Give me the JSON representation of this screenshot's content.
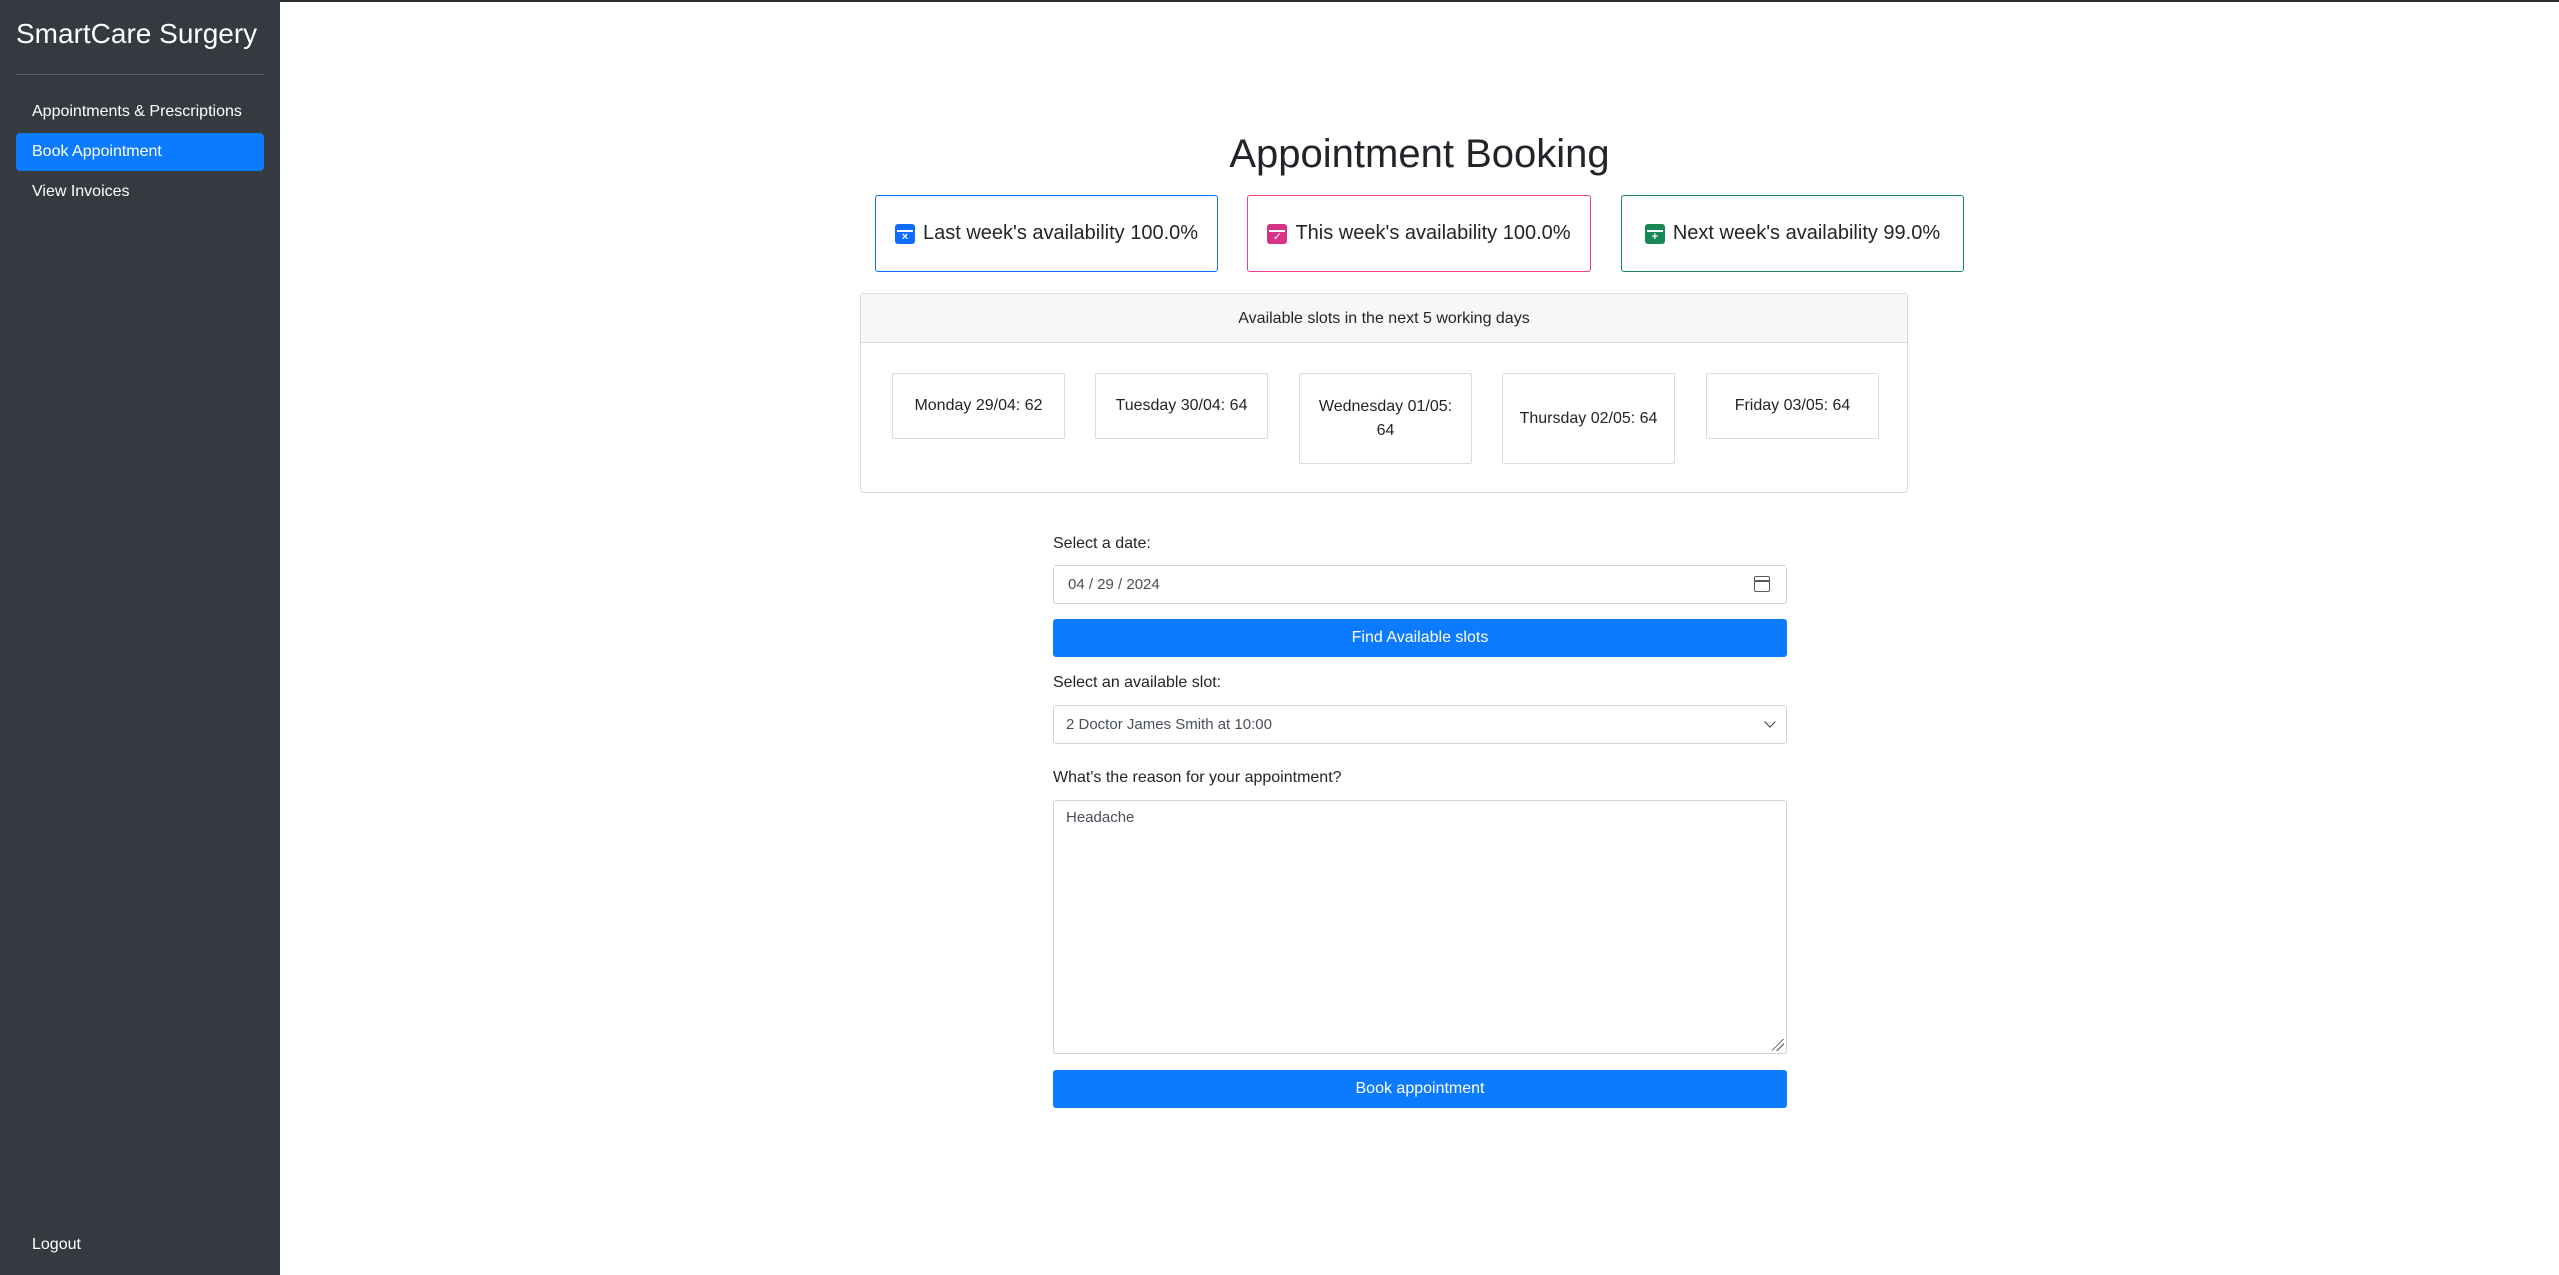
{
  "sidebar": {
    "brand": "SmartCare Surgery",
    "items": [
      {
        "label": "Appointments & Prescriptions"
      },
      {
        "label": "Book Appointment"
      },
      {
        "label": "View Invoices"
      }
    ],
    "logout_label": "Logout",
    "active_index": 1,
    "colors": {
      "background": "#343a40",
      "active": "#0d7bff"
    }
  },
  "main": {
    "title": "Appointment Booking",
    "availability": [
      {
        "label": "Last week's availability 100.0%",
        "icon": "calendar-x-icon",
        "color": "#0d6efd"
      },
      {
        "label": "This week's availability 100.0%",
        "icon": "calendar-check-icon",
        "color": "#e83e8c"
      },
      {
        "label": "Next week's availability 99.0%",
        "icon": "calendar-plus-icon",
        "color": "#198754"
      }
    ],
    "slots_panel": {
      "header": "Available slots in the next 5 working days",
      "days": [
        {
          "label": "Monday 29/04: 62"
        },
        {
          "label": "Tuesday 30/04: 64"
        },
        {
          "label": "Wednesday 01/05: 64"
        },
        {
          "label": "Thursday 02/05: 64"
        },
        {
          "label": "Friday 03/05: 64"
        }
      ]
    },
    "form": {
      "date_label": "Select a date:",
      "date_value": "04 / 29 / 2024",
      "find_button": "Find Available slots",
      "slot_label": "Select an available slot:",
      "slot_value": "2 Doctor James Smith at 10:00",
      "reason_label": "What's the reason for your appointment?",
      "reason_value": "Headache",
      "book_button": "Book appointment"
    }
  }
}
